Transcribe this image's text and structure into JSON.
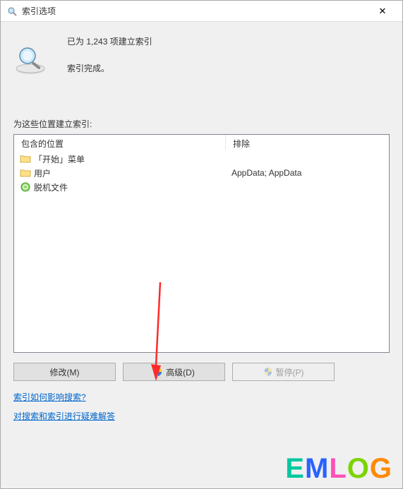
{
  "title": "索引选项",
  "close_label": "✕",
  "info": {
    "count_line": "已为 1,243 项建立索引",
    "status_line": "索引完成。"
  },
  "section_label": "为这些位置建立索引:",
  "columns": {
    "included": "包含的位置",
    "excluded": "排除"
  },
  "locations": [
    {
      "label": "「开始」菜单",
      "icon": "folder"
    },
    {
      "label": "用户",
      "icon": "folder"
    },
    {
      "label": "脱机文件",
      "icon": "sync"
    }
  ],
  "excluded_text": "AppData; AppData",
  "buttons": {
    "modify": "修改(M)",
    "advanced": "高级(D)",
    "pause": "暂停(P)"
  },
  "links": {
    "help1": "索引如何影响搜索?",
    "help2": "对搜索和索引进行疑难解答"
  },
  "watermark": "EMLOG"
}
